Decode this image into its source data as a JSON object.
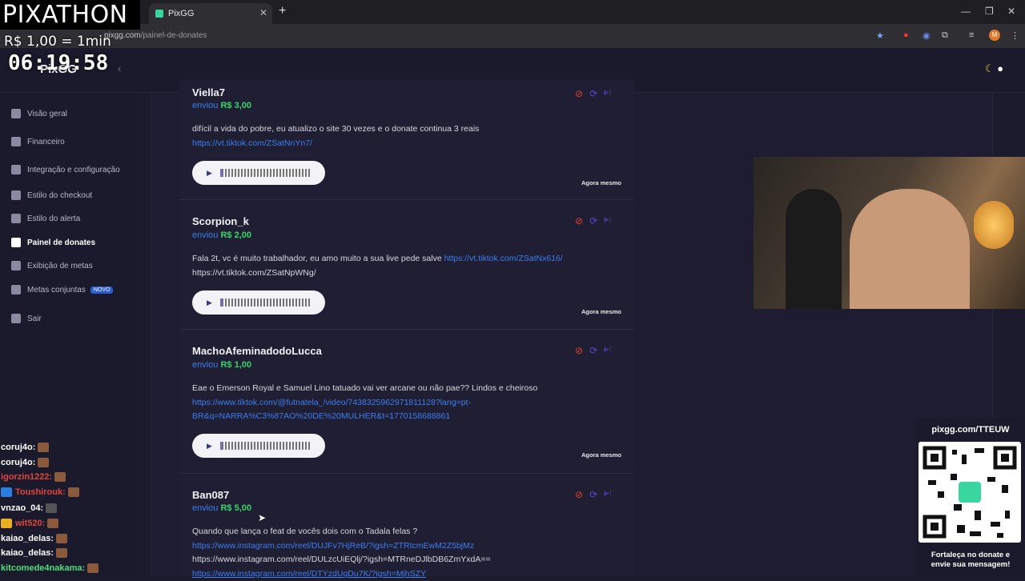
{
  "overlay": {
    "title": "PIXATHON",
    "rate": "R$ 1,00 = 1min",
    "timer": "06:19:58"
  },
  "browser": {
    "tab_title": "PixGG",
    "url_host": "pixgg.com",
    "url_path": "/painel-de-donates",
    "profile_initial": "M"
  },
  "app": {
    "logo": "PixGG"
  },
  "sidebar": {
    "items": [
      {
        "label": "Visão geral",
        "icon": "home-icon"
      },
      {
        "label": "Financeiro",
        "icon": "wallet-icon"
      },
      {
        "label": "Integração e configuração",
        "icon": "sliders-icon"
      },
      {
        "label": "Estilo do checkout",
        "icon": "palette-icon"
      },
      {
        "label": "Estilo do alerta",
        "icon": "palette-icon"
      },
      {
        "label": "Painel de donates",
        "icon": "rocket-icon",
        "active": true
      },
      {
        "label": "Exibição de metas",
        "icon": "star-icon"
      },
      {
        "label": "Metas conjuntas",
        "icon": "rocket-icon",
        "badge": "NOVO"
      },
      {
        "label": "Sair",
        "icon": "logout-icon"
      }
    ]
  },
  "donations": [
    {
      "donor": "Viella7",
      "sent_label": "enviou",
      "amount": "R$ 3,00",
      "message": "difícil a vida do pobre, eu atualizo o site 30 vezes e o donate continua 3 reais",
      "links": [
        "https://vt.tiktok.com/ZSatNnYn7/"
      ],
      "time": "Agora mesmo"
    },
    {
      "donor": "Scorpion_k",
      "sent_label": "enviou",
      "amount": "R$ 2,00",
      "message": "Fala 2t, vc é muito trabalhador, eu amo muito a sua live pede salve ",
      "inline_link": "https://vt.tiktok.com/ZSatNx616/",
      "message_tail": "https://vt.tiktok.com/ZSatNpWNg/",
      "time": "Agora mesmo"
    },
    {
      "donor": "MachoAfeminadodoLucca",
      "sent_label": "enviou",
      "amount": "R$ 1,00",
      "message": "Eae o Emerson Royal e Samuel Lino tatuado vai ver arcane ou não pae?? Lindos e cheiroso",
      "links": [
        "https://www.tiktok.com/@futnatela_/video/7438325962971811128?lang=pt-",
        "BR&q=NARRA%C3%87AO%20DE%20MULHER&t=1770158688861"
      ],
      "time": "Agora mesmo"
    },
    {
      "donor": "Ban087",
      "sent_label": "enviou",
      "amount": "R$ 5,00",
      "message": "Quando que lança o feat de vocês dois com o Tadala felas ?",
      "links": [
        "https://www.instagram.com/reel/DUJFv7HjReB/?igsh=ZTRtcmEwM2Z5bjMz"
      ],
      "plain": "https://www.instagram.com/reel/DULzcUiEQlj/?igsh=MTRneDJlbDB6ZmYxdA==",
      "link_tail": "https://www.instagram.com/reel/DTYzdUqDu7K/?igsh=MjhSZY"
    }
  ],
  "chat": [
    {
      "user": "coruj4o:",
      "color": "#ffffff"
    },
    {
      "user": "coruj4o:",
      "color": "#ffffff"
    },
    {
      "user": "igorzin1222:",
      "color": "#e0463c"
    },
    {
      "user": "Toushirouk:",
      "color": "#e0463c"
    },
    {
      "user": "vnzao_04:",
      "color": "#ffffff"
    },
    {
      "user": "wit520:",
      "color": "#e0463c"
    },
    {
      "user": "kaiao_delas:",
      "color": "#ffffff"
    },
    {
      "user": "kaiao_delas:",
      "color": "#ffffff"
    },
    {
      "user": "kitcomede4nakama:",
      "color": "#4be07a"
    }
  ],
  "qr_panel": {
    "url": "pixgg.com/TTEUW",
    "footer_line1": "Fortaleça no donate e",
    "footer_line2": "envie sua mensagem!"
  },
  "colors": {
    "accent_blue": "#3d7ef0",
    "amount_green": "#3bd46b",
    "ban_red": "#e8412f",
    "bg": "#1c1b2e"
  }
}
